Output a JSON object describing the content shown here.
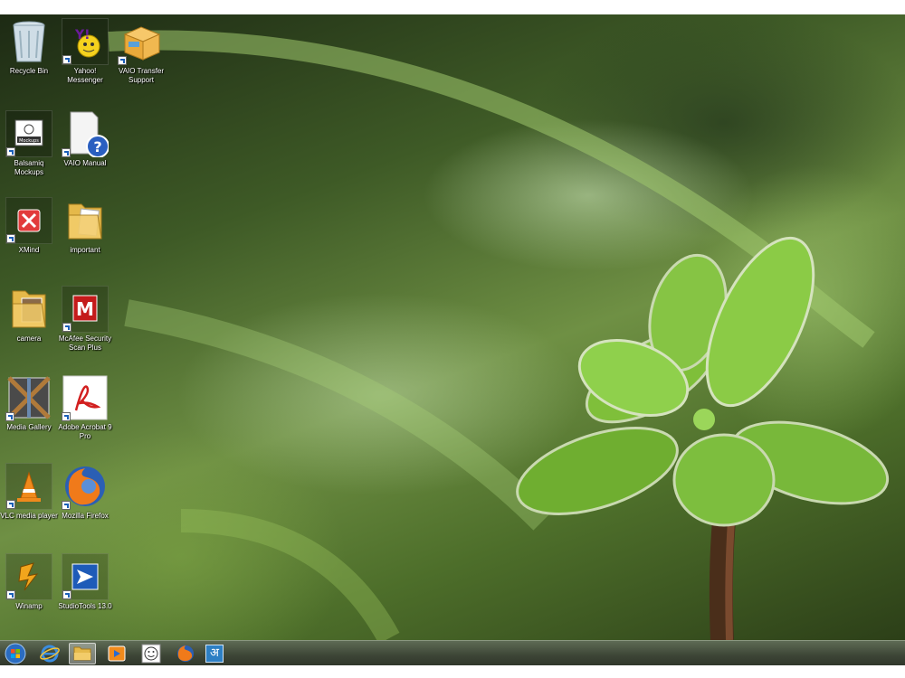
{
  "desktop": {
    "icons": [
      {
        "id": "recycle-bin",
        "label": "Recycle Bin",
        "shortcut": false
      },
      {
        "id": "yahoo-messenger",
        "label": "Yahoo! Messenger",
        "shortcut": true
      },
      {
        "id": "vaio-transfer",
        "label": "VAIO Transfer Support",
        "shortcut": true
      },
      {
        "id": "balsamiq",
        "label": "Balsamiq Mockups",
        "shortcut": true
      },
      {
        "id": "vaio-manual",
        "label": "VAIO Manual",
        "shortcut": true
      },
      {
        "id": "xmind",
        "label": "XMind",
        "shortcut": true
      },
      {
        "id": "important",
        "label": "important",
        "shortcut": false
      },
      {
        "id": "camera",
        "label": "camera",
        "shortcut": false
      },
      {
        "id": "mcafee",
        "label": "McAfee Security Scan Plus",
        "shortcut": true
      },
      {
        "id": "media-gallery",
        "label": "Media Gallery",
        "shortcut": true
      },
      {
        "id": "adobe-acrobat",
        "label": "Adobe Acrobat 9 Pro",
        "shortcut": true
      },
      {
        "id": "vlc",
        "label": "VLC media player",
        "shortcut": true
      },
      {
        "id": "firefox",
        "label": "Mozilla Firefox",
        "shortcut": true
      },
      {
        "id": "winamp",
        "label": "Winamp",
        "shortcut": true
      },
      {
        "id": "studiotools",
        "label": "StudioTools 13.0",
        "shortcut": true
      }
    ],
    "balsamiq_icon_text": "Mockups",
    "vaio_manual_symbol": "?",
    "mcafee_letter": "M",
    "hindi_glyph": "अ"
  },
  "taskbar": {
    "items": [
      {
        "id": "start",
        "icon": "windows-orb-icon"
      },
      {
        "id": "ie",
        "icon": "internet-explorer-icon"
      },
      {
        "id": "explorer",
        "icon": "folder-icon",
        "active": true
      },
      {
        "id": "media-player",
        "icon": "media-player-icon"
      },
      {
        "id": "smiley",
        "icon": "smiley-icon"
      },
      {
        "id": "firefox",
        "icon": "firefox-icon"
      },
      {
        "id": "language",
        "icon": "hindi-language-icon"
      }
    ]
  },
  "colors": {
    "taskbar": "#3d4536",
    "accent": "#1c5fb8"
  }
}
